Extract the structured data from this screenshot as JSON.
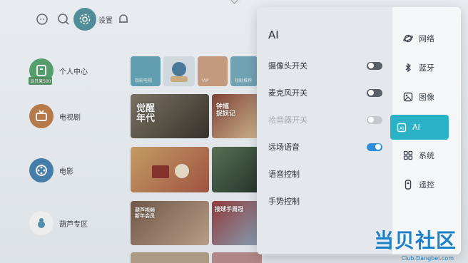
{
  "topbar": {
    "settings_label": "设置"
  },
  "nav": {
    "items": [
      {
        "label": "个人中心",
        "badge": "当贝果500"
      },
      {
        "label": "电视剧"
      },
      {
        "label": "电影"
      },
      {
        "label": "葫芦专区"
      }
    ]
  },
  "tiles": {
    "row1": [
      "观影电视",
      "VIP",
      "短剧推荐"
    ],
    "row2": [
      {
        "title": "觉醒\n年代"
      },
      {
        "title": "钟馗\n捉妖记"
      }
    ],
    "row4": [
      {
        "title": "葫芦视频\n新年会员"
      },
      {
        "title": "接球手周冠\n"
      }
    ]
  },
  "panel": {
    "title": "AI",
    "options": [
      {
        "label": "摄像头开关",
        "state": "off",
        "enabled": true
      },
      {
        "label": "麦克风开关",
        "state": "off",
        "enabled": true
      },
      {
        "label": "拾音器开关",
        "state": "off",
        "enabled": false
      },
      {
        "label": "远场语音",
        "state": "on",
        "enabled": true
      },
      {
        "label": "语音控制",
        "state": "none",
        "enabled": true
      },
      {
        "label": "手势控制",
        "state": "none",
        "enabled": true
      }
    ],
    "side": [
      {
        "label": "网络",
        "icon": "planet-icon"
      },
      {
        "label": "蓝牙",
        "icon": "bluetooth-icon"
      },
      {
        "label": "图像",
        "icon": "image-icon"
      },
      {
        "label": "AI",
        "icon": "ai-icon",
        "active": true
      },
      {
        "label": "系统",
        "icon": "grid-icon"
      },
      {
        "label": "遥控",
        "icon": "remote-icon"
      }
    ]
  },
  "watermark": {
    "main": "当贝社区",
    "sub": "Club.Dangbei.com"
  },
  "colors": {
    "accent": "#2ab2c6",
    "toggle_on": "#2e8fd6"
  }
}
